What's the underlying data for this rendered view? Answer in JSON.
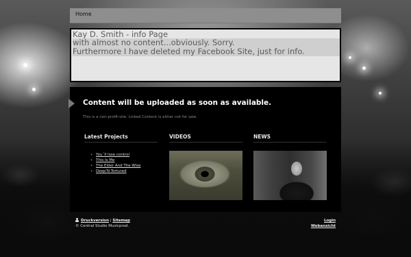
{
  "nav": {
    "home_label": "Home"
  },
  "info": {
    "line1": "Kay D. Smith - info Page",
    "line2": "with almost no content...obviously. Sorry.",
    "line3": "Furthermore I have deleted my Facebook Site, just for info."
  },
  "main": {
    "headline": "Content will be uploaded as soon as available.",
    "notice": "This is a non-profit-site. Linked Content is either not for sale."
  },
  "columns": {
    "projects": {
      "title": "Latest Projects",
      "items": [
        "You´ll lose control",
        "This Is Me",
        "The Elder And The Wise",
        "Deep'N Tortured"
      ]
    },
    "videos": {
      "title": "VIDEOS"
    },
    "news": {
      "title": "NEWS"
    }
  },
  "footer": {
    "print_label": "Druckversion",
    "separator": "|",
    "sitemap_label": "Sitemap",
    "copyright": "© Central Studio Musicprod.",
    "login_label": "Login",
    "web_view_label": "Webansicht"
  },
  "icons": {
    "print": "person-icon",
    "tab_marker": "arrow-right-icon"
  }
}
